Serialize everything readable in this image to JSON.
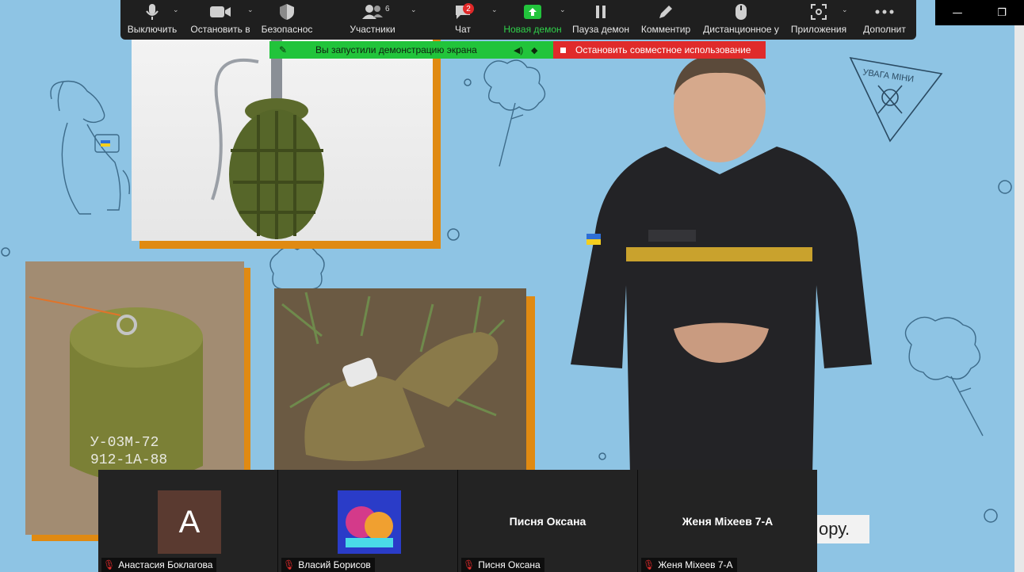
{
  "toolbar": {
    "items": [
      {
        "label": "Выключить",
        "icon": "mic-icon"
      },
      {
        "label": "Остановить в",
        "icon": "video-camera-icon"
      },
      {
        "label": "Безопаснос",
        "icon": "shield-icon"
      },
      {
        "label": "Участники",
        "icon": "participants-icon",
        "count": "6"
      },
      {
        "label": "Чат",
        "icon": "chat-icon",
        "badge": "2"
      },
      {
        "label": "Новая демон",
        "icon": "share-screen-icon"
      },
      {
        "label": "Пауза демон",
        "icon": "pause-icon"
      },
      {
        "label": "Комментир",
        "icon": "pencil-icon"
      },
      {
        "label": "Дистанционное у",
        "icon": "mouse-icon"
      },
      {
        "label": "Приложения",
        "icon": "apps-icon"
      },
      {
        "label": "Дополнит",
        "icon": "more-icon"
      }
    ]
  },
  "share_banner": {
    "text": "Вы запустили демонстрацию экрана",
    "stop_text": "Остановить совместное использование"
  },
  "slide": {
    "sign_text": "УВАГА МІНИ",
    "mine1_text_line1": "У-03М-72",
    "mine1_text_line2": "912-1А-88",
    "caption_fragment": "ору."
  },
  "participants": [
    {
      "name": "Анастасия Боклагова",
      "avatar": "A",
      "display": "letter"
    },
    {
      "name": "Власий Борисов",
      "display": "image"
    },
    {
      "name": "Писня Оксана",
      "display": "name"
    },
    {
      "name": "Женя Міхеев 7-А",
      "display": "name"
    }
  ],
  "colors": {
    "background": "#8ec4e4",
    "accent_orange": "#e08a12",
    "toolbar": "#1f1f1f",
    "share_green": "#21c43b",
    "stop_red": "#e02b2b"
  }
}
